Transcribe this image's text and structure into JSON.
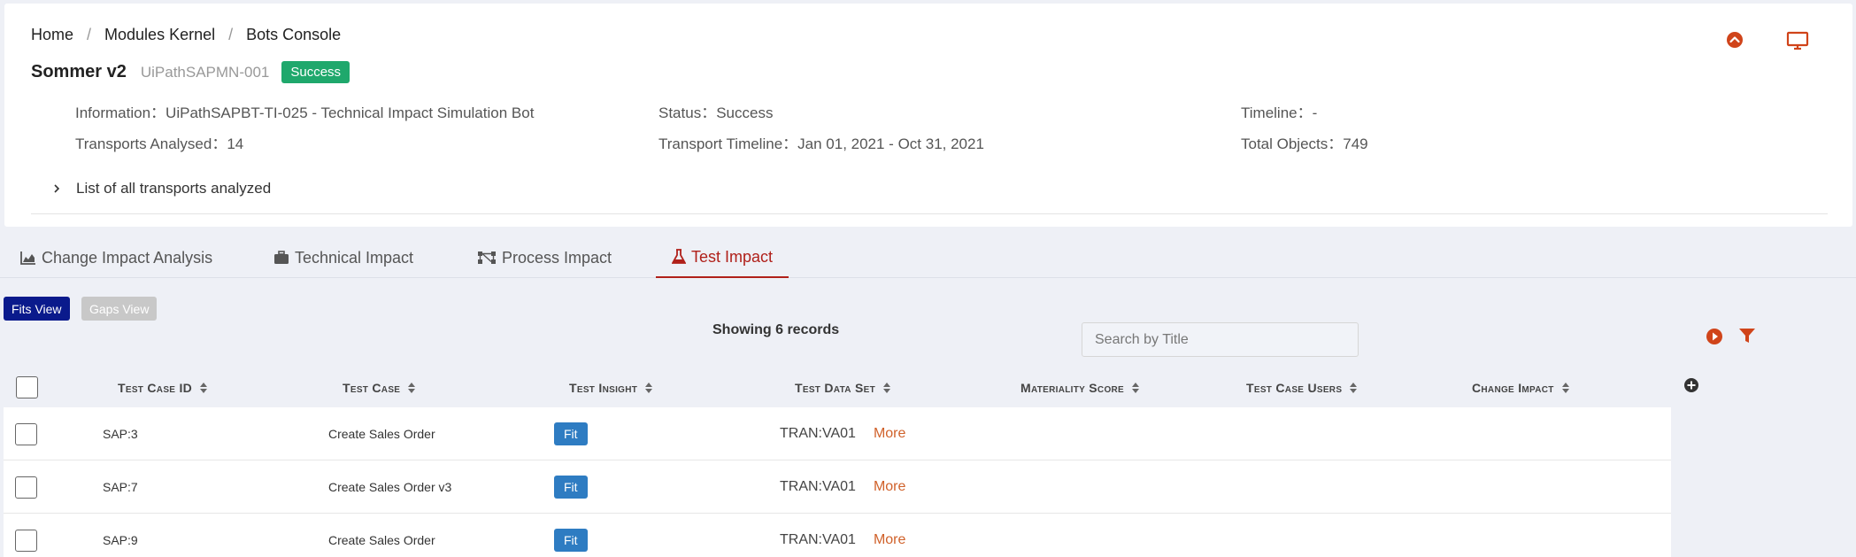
{
  "breadcrumb": [
    "Home",
    "Modules Kernel",
    "Bots Console"
  ],
  "bot": {
    "name": "Sommer v2",
    "id": "UiPathSAPMN-001",
    "status_badge": "Success"
  },
  "info": {
    "information": {
      "label": "Information",
      "value": "UiPathSAPBT-TI-025 - Technical Impact Simulation Bot"
    },
    "status": {
      "label": "Status",
      "value": "Success"
    },
    "timeline": {
      "label": "Timeline",
      "value": "-"
    },
    "transports_analysed": {
      "label": "Transports Analysed",
      "value": "14"
    },
    "transport_timeline": {
      "label": "Transport Timeline",
      "value": "Jan 01, 2021 - Oct 31, 2021"
    },
    "total_objects": {
      "label": "Total Objects",
      "value": "749"
    }
  },
  "transports_toggle": "List of all transports analyzed",
  "tabs": [
    {
      "label": "Change Impact Analysis",
      "icon": "area-chart-icon"
    },
    {
      "label": "Technical Impact",
      "icon": "briefcase-icon"
    },
    {
      "label": "Process Impact",
      "icon": "process-nodes-icon"
    },
    {
      "label": "Test Impact",
      "icon": "flask-icon",
      "active": true
    }
  ],
  "view_buttons": {
    "fits": "Fits View",
    "gaps": "Gaps View"
  },
  "records_text": "Showing 6 records",
  "search": {
    "placeholder": "Search by Title",
    "value": ""
  },
  "columns": [
    "Test Case ID",
    "Test Case",
    "Test Insight",
    "Test Data Set",
    "Materiality Score",
    "Test Case Users",
    "Change Impact"
  ],
  "rows": [
    {
      "id": "SAP:3",
      "test_case": "Create Sales Order",
      "insight": "Fit",
      "data_set": "TRAN:VA01",
      "more": "More"
    },
    {
      "id": "SAP:7",
      "test_case": "Create Sales Order v3",
      "insight": "Fit",
      "data_set": "TRAN:VA01",
      "more": "More"
    },
    {
      "id": "SAP:9",
      "test_case": "Create Sales Order",
      "insight": "Fit",
      "data_set": "TRAN:VA01",
      "more": "More"
    }
  ],
  "colors": {
    "accent_red": "#b0201a",
    "orange": "#d0612a",
    "success": "#1fa86c",
    "fit_blue": "#2e7cc2",
    "fits_btn": "#0a1a8c"
  }
}
